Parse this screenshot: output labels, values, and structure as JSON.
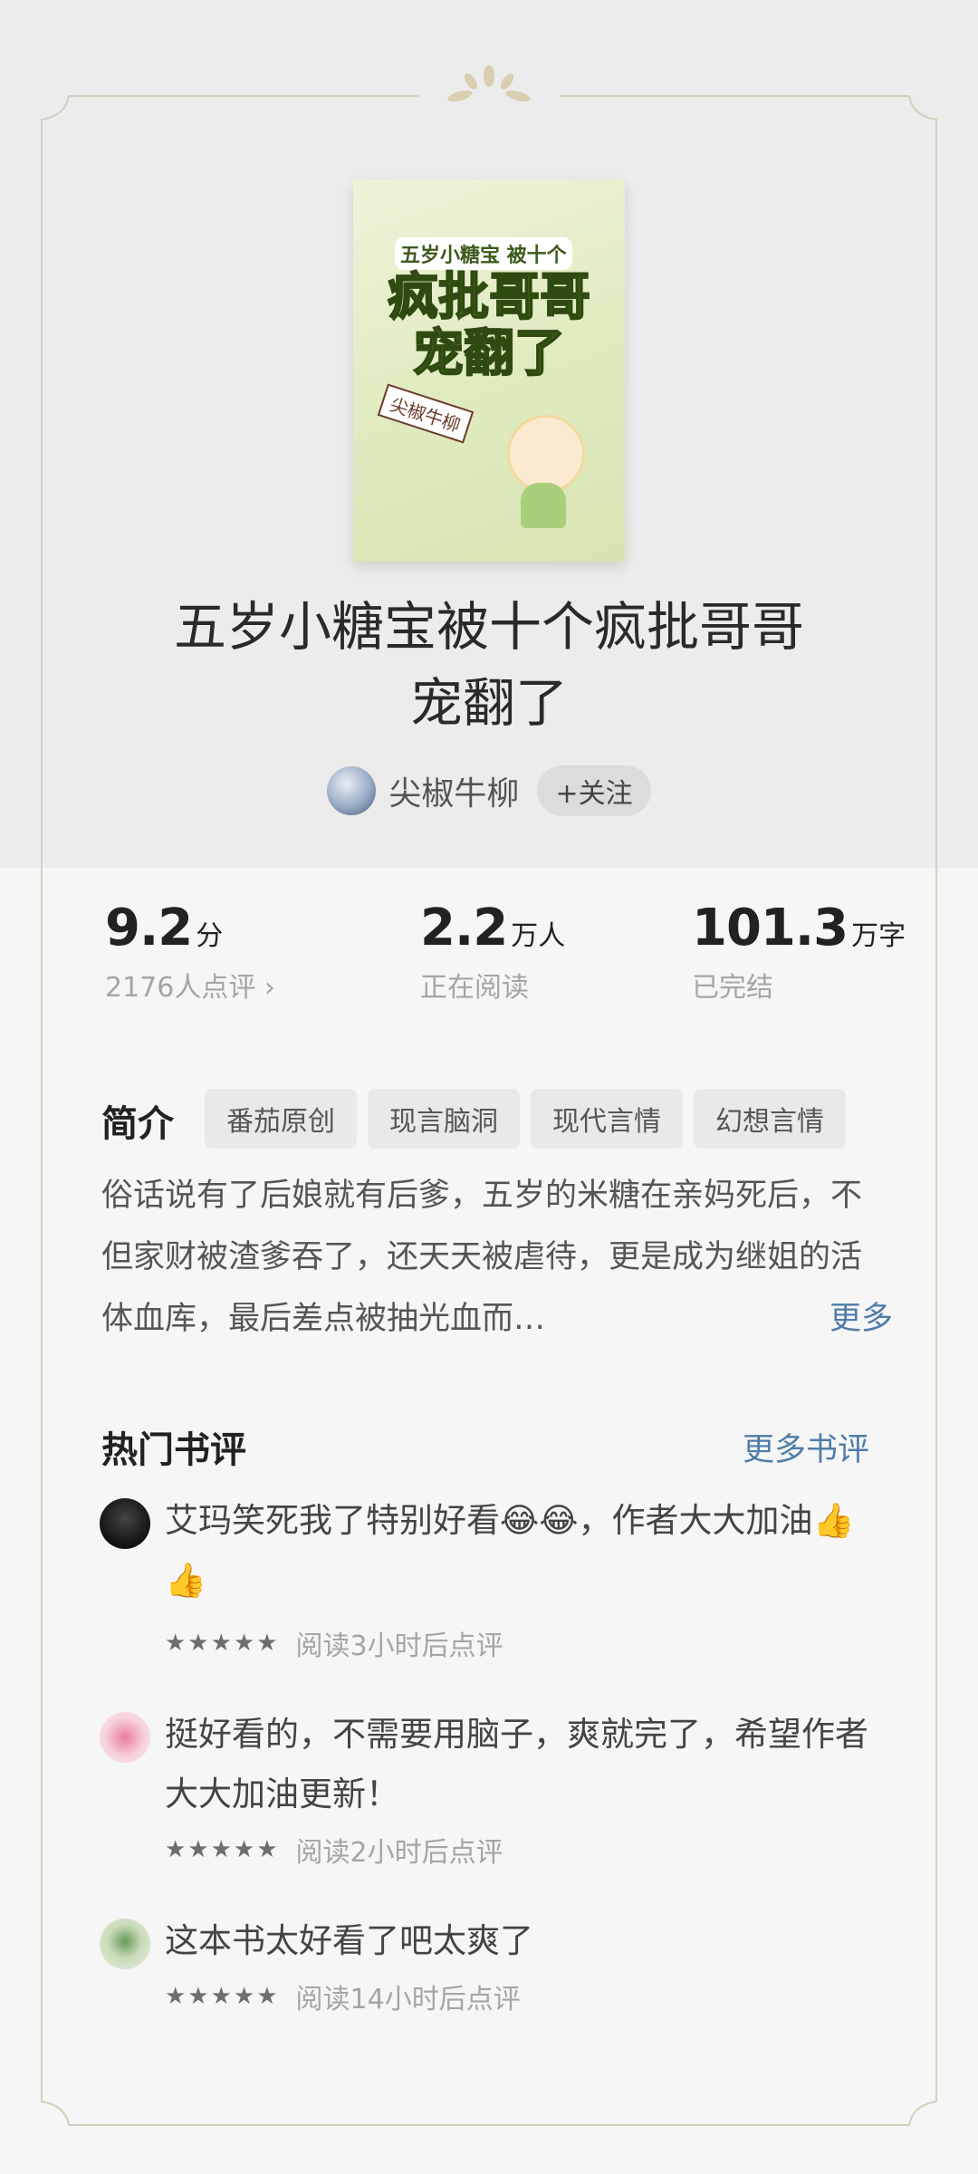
{
  "book": {
    "title_line1": "五岁小糖宝被十个疯批哥哥",
    "title_line2": "宠翻了",
    "cover": {
      "small_text": "五岁小糖宝 被十个",
      "big_text": "疯批哥哥宠翻了",
      "author_tag": "尖椒牛柳"
    }
  },
  "author": {
    "name": "尖椒牛柳",
    "follow_label": "+关注",
    "avatar_icon": "sky-avatar"
  },
  "stats": [
    {
      "value": "9.2",
      "unit": "分",
      "sub": "2176人点评 ›"
    },
    {
      "value": "2.2",
      "unit": "万人",
      "sub": "正在阅读"
    },
    {
      "value": "101.3",
      "unit": "万字",
      "sub": "已完结"
    }
  ],
  "intro": {
    "heading": "简介",
    "tags": [
      "番茄原创",
      "现言脑洞",
      "现代言情",
      "幻想言情"
    ],
    "text": "俗话说有了后娘就有后爹，五岁的米糖在亲妈死后，不但家财被渣爹吞了，还天天被虐待，更是成为继姐的活体血库，最后差点被抽光血而…",
    "more_label": "更多"
  },
  "reviews_section": {
    "heading": "热门书评",
    "more_label": "更多书评",
    "items": [
      {
        "text": "艾玛笑死我了特别好看😂😂，作者大大加油👍👍",
        "stars": "★★★★★",
        "meta": "阅读3小时后点评",
        "avatar_color": "#1e1e1e"
      },
      {
        "text": "挺好看的，不需要用脑子，爽就完了，希望作者大大加油更新！",
        "stars": "★★★★★",
        "meta": "阅读2小时后点评",
        "avatar_color": "#f6d2da"
      },
      {
        "text": "这本书太好看了吧太爽了",
        "stars": "★★★★★",
        "meta": "阅读14小时后点评",
        "avatar_color": "#dfe6d5"
      }
    ]
  },
  "colors": {
    "link": "#4f7ca8",
    "muted": "#a5a5a5",
    "frame": "#d6cfbd"
  }
}
